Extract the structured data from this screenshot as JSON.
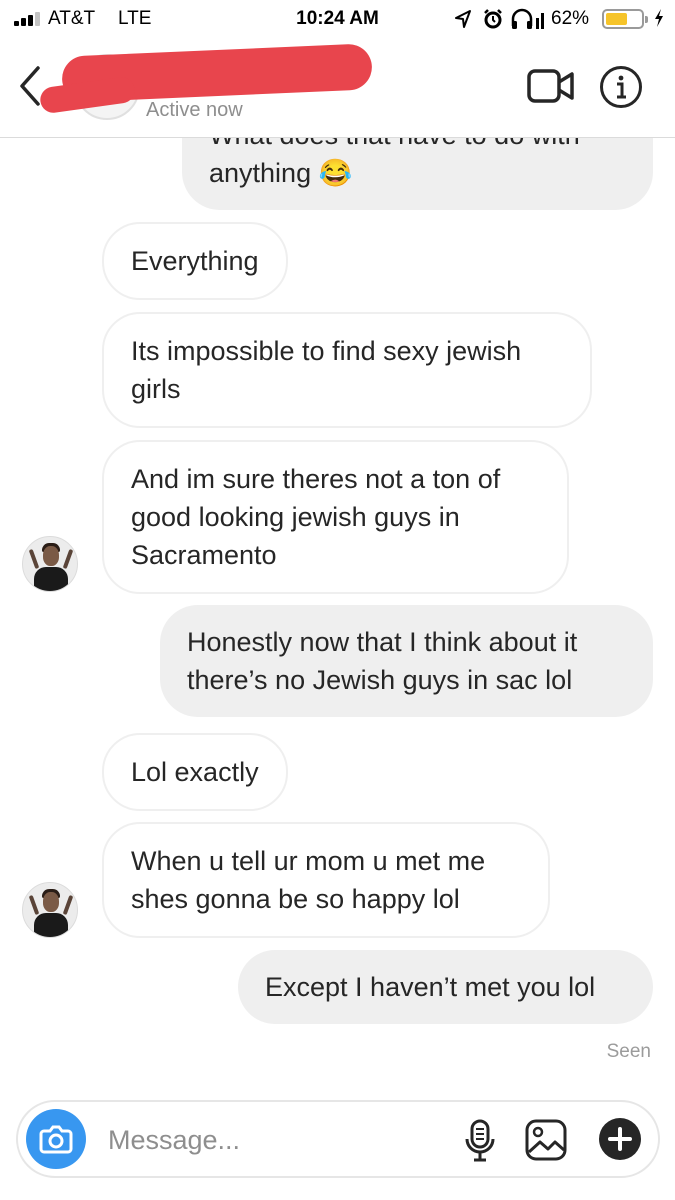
{
  "status_bar": {
    "carrier": "AT&T",
    "network": "LTE",
    "time": "10:24 AM",
    "battery_percent": "62%",
    "battery_level": 0.62,
    "icons": [
      "signal-bars-icon",
      "location-arrow-icon",
      "alarm-icon",
      "headphones-icon",
      "battery-icon",
      "charging-bolt-icon"
    ]
  },
  "header": {
    "status": "Active now",
    "icons": [
      "back-chevron-icon",
      "video-call-icon",
      "info-icon"
    ]
  },
  "messages": [
    {
      "side": "out",
      "text": "What does that have to do with anything 😂"
    },
    {
      "side": "in",
      "text": "Everything"
    },
    {
      "side": "in",
      "text": "Its impossible to find sexy jewish girls"
    },
    {
      "side": "in",
      "text": "And im sure theres not a ton of good looking jewish guys in Sacramento"
    },
    {
      "side": "out",
      "text": "Honestly now that I think about it there’s no Jewish guys in sac lol"
    },
    {
      "side": "in",
      "text": "Lol exactly"
    },
    {
      "side": "in",
      "text": "When u tell ur mom u met me shes gonna be so happy lol"
    },
    {
      "side": "out",
      "text": "Except I haven’t met you lol"
    }
  ],
  "seen_label": "Seen",
  "composer": {
    "placeholder": "Message...",
    "icons": [
      "camera-icon",
      "microphone-icon",
      "gallery-icon",
      "plus-icon"
    ]
  },
  "colors": {
    "accent": "#3897f0",
    "outgoing_bubble": "#efefef",
    "redaction": "#e8454d",
    "battery": "#f6c42a"
  }
}
